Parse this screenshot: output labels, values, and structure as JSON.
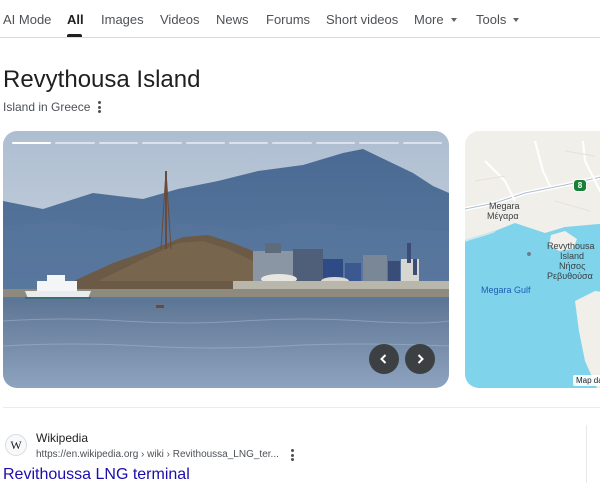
{
  "tabs": [
    {
      "label": "AI Mode"
    },
    {
      "label": "All"
    },
    {
      "label": "Images"
    },
    {
      "label": "Videos"
    },
    {
      "label": "News"
    },
    {
      "label": "Forums"
    },
    {
      "label": "Short videos"
    },
    {
      "label": "More"
    },
    {
      "label": "Tools"
    }
  ],
  "active_tab": "All",
  "entity": {
    "title": "Revythousa Island",
    "subtitle": "Island in Greece",
    "more_options_icon": "vertical-dots-icon"
  },
  "photo": {
    "slides_total": 10,
    "current_slide": 1,
    "prev_icon": "chevron-left-icon",
    "next_icon": "chevron-right-icon"
  },
  "map": {
    "labels": {
      "megara_en": "Megara",
      "megara_gr": "Μέγαρα",
      "island_en_1": "Revythousa",
      "island_en_2": "Island",
      "island_gr_1": "Νήσος",
      "island_gr_2": "Ρεβυθούσα",
      "gulf": "Megara Gulf",
      "route": "8"
    },
    "credit": "Map data"
  },
  "colors": {
    "link": "#1a0dab",
    "water": "#7fd3ea",
    "land": "#f1efe9",
    "route_badge": "#188038"
  },
  "result": {
    "site_name": "Wikipedia",
    "favicon_letter": "W",
    "url": "https://en.wikipedia.org › wiki › Revithoussa_LNG_ter...",
    "title": "Revithoussa LNG terminal"
  }
}
